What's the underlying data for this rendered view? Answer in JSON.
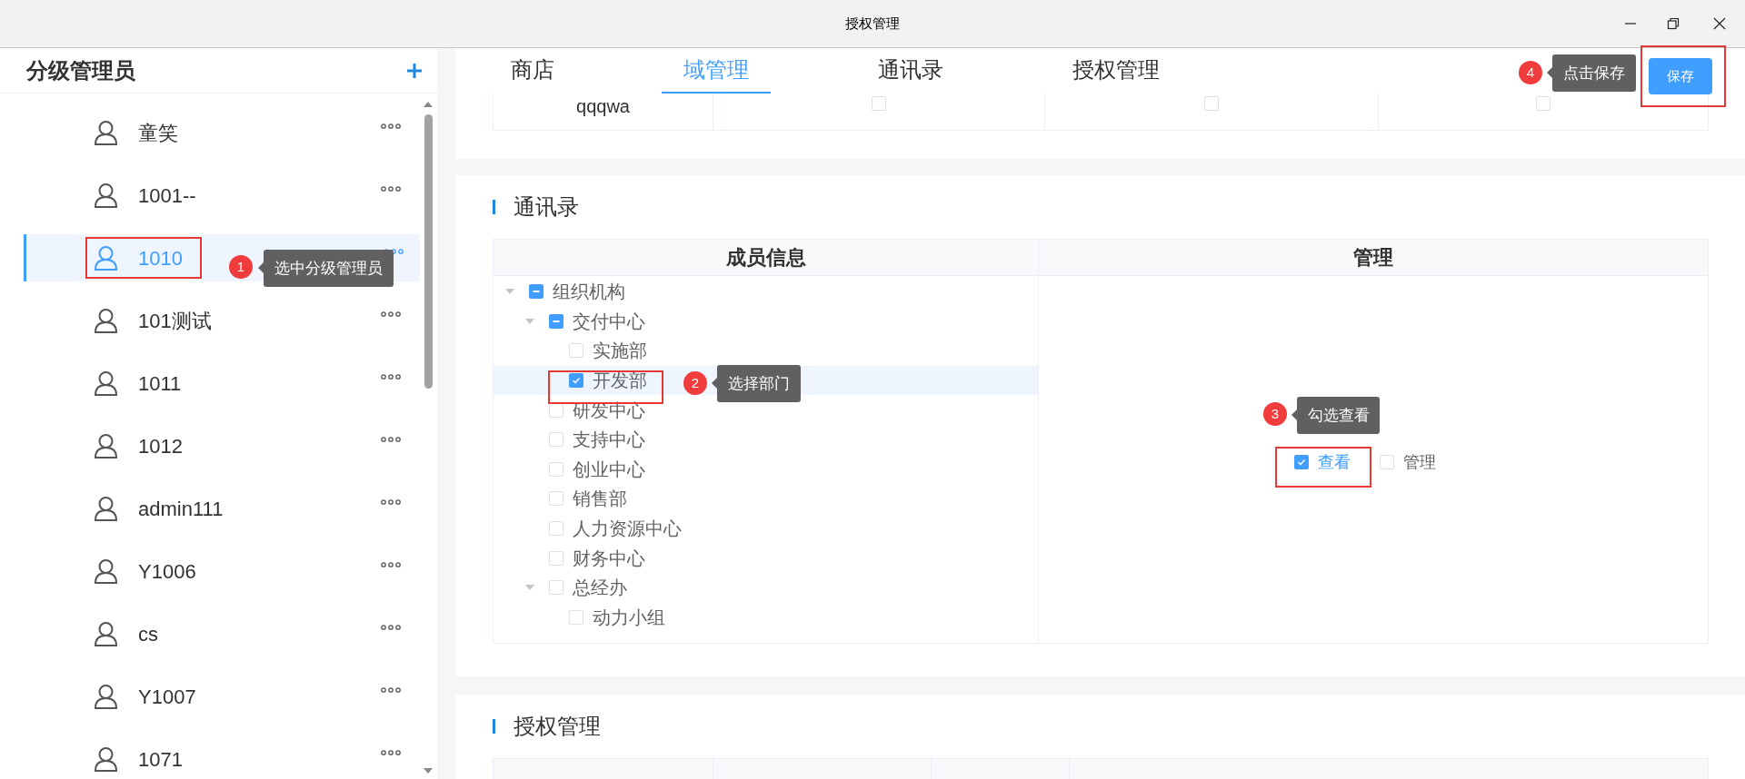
{
  "window": {
    "title": "授权管理"
  },
  "sidebar": {
    "title": "分级管理员",
    "items": [
      {
        "name": "童笑",
        "selected": false
      },
      {
        "name": "1001--",
        "selected": false
      },
      {
        "name": "1010",
        "selected": true
      },
      {
        "name": "101测试",
        "selected": false
      },
      {
        "name": "1011",
        "selected": false
      },
      {
        "name": "1012",
        "selected": false
      },
      {
        "name": "admin111",
        "selected": false
      },
      {
        "name": "Y1006",
        "selected": false
      },
      {
        "name": "cs",
        "selected": false
      },
      {
        "name": "Y1007",
        "selected": false
      },
      {
        "name": "1071",
        "selected": false
      }
    ]
  },
  "tabs": [
    {
      "label": "商店",
      "selected": false
    },
    {
      "label": "域管理",
      "selected": true
    },
    {
      "label": "通讯录",
      "selected": false
    },
    {
      "label": "授权管理",
      "selected": false
    }
  ],
  "save_button": "保存",
  "top_table": {
    "rows": [
      {
        "name": "qqqwa",
        "checks": [
          false,
          false,
          false
        ]
      }
    ]
  },
  "contacts": {
    "title": "通讯录",
    "columns": [
      "成员信息",
      "管理"
    ],
    "tree": [
      {
        "label": "组织机构",
        "checked": false,
        "indeterminate": true,
        "expanded": true,
        "selected": false,
        "children": [
          {
            "label": "交付中心",
            "checked": false,
            "indeterminate": true,
            "expanded": true,
            "selected": false,
            "children": [
              {
                "label": "实施部",
                "checked": false,
                "indeterminate": false,
                "selected": false
              },
              {
                "label": "开发部",
                "checked": true,
                "indeterminate": false,
                "selected": true
              }
            ]
          },
          {
            "label": "研发中心",
            "checked": false,
            "indeterminate": false,
            "selected": false
          },
          {
            "label": "支持中心",
            "checked": false,
            "indeterminate": false,
            "selected": false
          },
          {
            "label": "创业中心",
            "checked": false,
            "indeterminate": false,
            "selected": false
          },
          {
            "label": "销售部",
            "checked": false,
            "indeterminate": false,
            "selected": false
          },
          {
            "label": "人力资源中心",
            "checked": false,
            "indeterminate": false,
            "selected": false
          },
          {
            "label": "财务中心",
            "checked": false,
            "indeterminate": false,
            "selected": false
          },
          {
            "label": "总经办",
            "checked": false,
            "indeterminate": false,
            "expanded": true,
            "selected": false,
            "children": [
              {
                "label": "动力小组",
                "checked": false,
                "indeterminate": false,
                "selected": false
              }
            ]
          }
        ]
      }
    ],
    "permissions": [
      {
        "label": "查看",
        "checked": true
      },
      {
        "label": "管理",
        "checked": false
      }
    ]
  },
  "auth": {
    "title": "授权管理"
  },
  "annotations": [
    {
      "number": "1",
      "text": "选中分级管理员"
    },
    {
      "number": "2",
      "text": "选择部门"
    },
    {
      "number": "3",
      "text": "勾选查看"
    },
    {
      "number": "4",
      "text": "点击保存"
    }
  ]
}
